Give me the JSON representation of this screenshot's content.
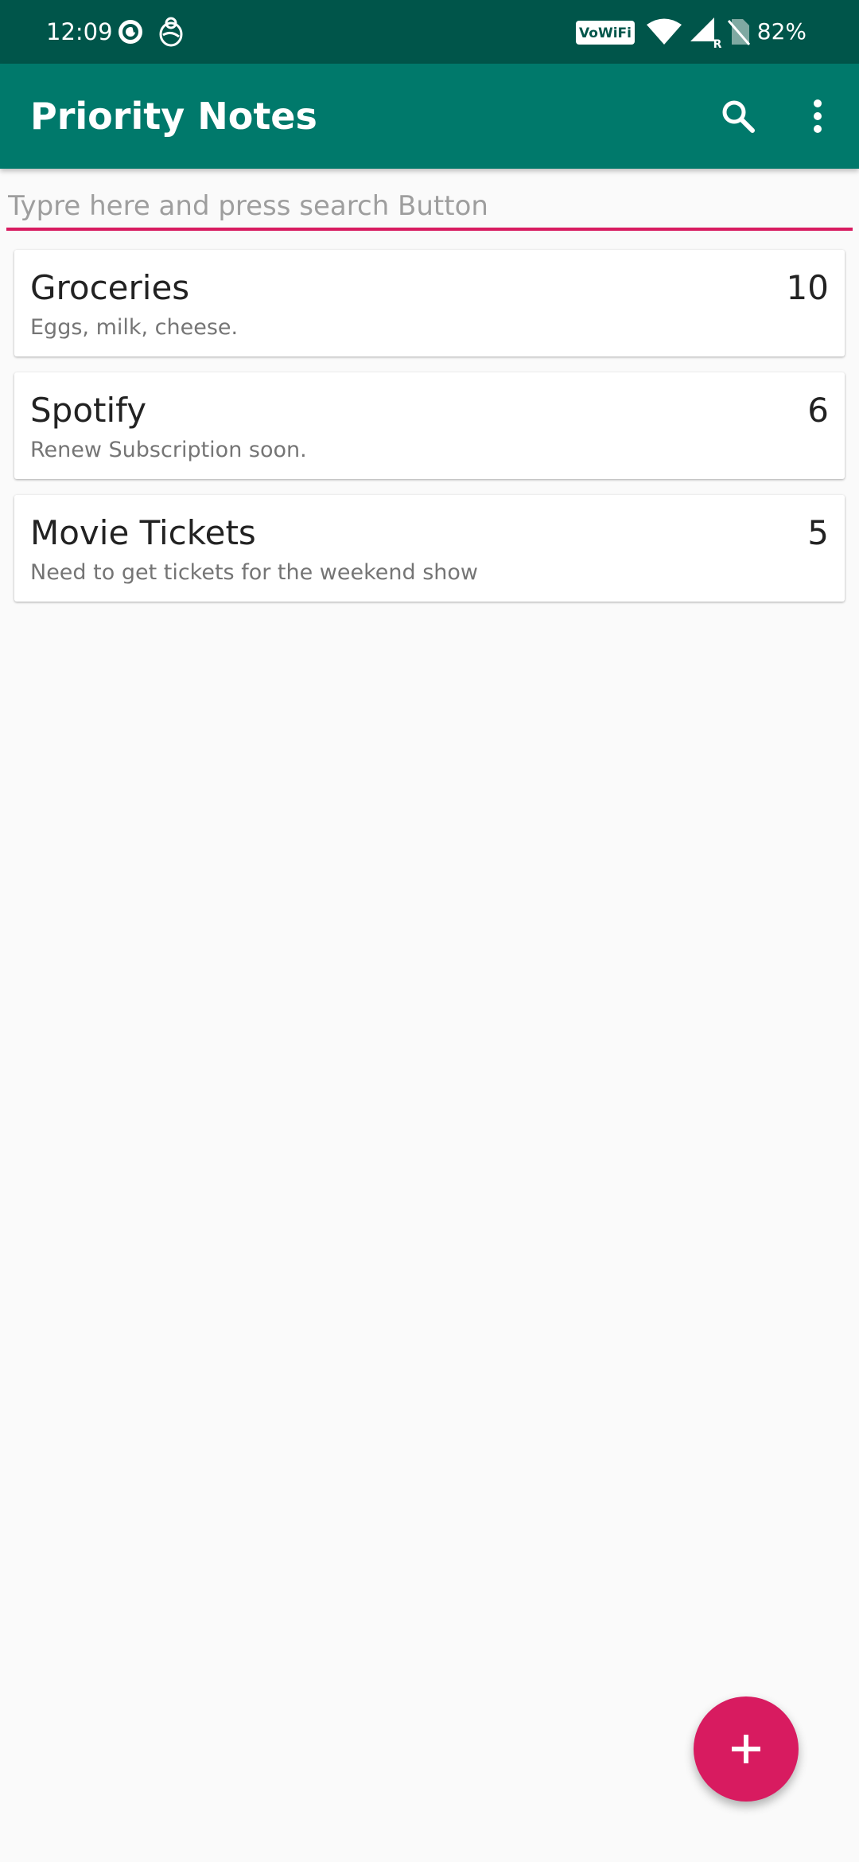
{
  "status_bar": {
    "time": "12:09",
    "left_icons": [
      "sync-icon",
      "bug-icon"
    ],
    "right_icons": [
      "vowifi-icon",
      "wifi-icon",
      "signal-roaming-icon",
      "no-sim-icon"
    ],
    "vowifi_label": "VoWiFi",
    "roaming_label": "R",
    "battery": "82%"
  },
  "app_bar": {
    "title": "Priority Notes",
    "actions": [
      "search-icon",
      "more-vert-icon"
    ],
    "background": "#00796b"
  },
  "search": {
    "placeholder": "Typre here and press search Button",
    "value": "",
    "accent": "#d81b60"
  },
  "notes": [
    {
      "title": "Groceries",
      "description": "Eggs, milk, cheese.",
      "priority": "10"
    },
    {
      "title": "Spotify",
      "description": "Renew Subscription soon.",
      "priority": "6"
    },
    {
      "title": "Movie Tickets",
      "description": "Need to get tickets for the weekend show",
      "priority": "5"
    }
  ],
  "fab": {
    "icon": "plus-icon",
    "color": "#d81b60"
  }
}
